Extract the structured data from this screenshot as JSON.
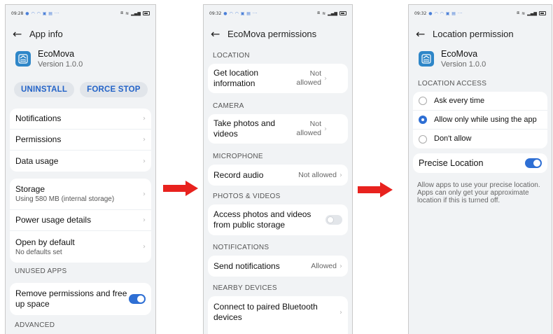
{
  "arrow_color": "#e8221e",
  "accent_color": "#2e6fd4",
  "screen1": {
    "status": {
      "time": "09:28",
      "net": "0.0\nK/s",
      "icons": "signal-wifi-battery"
    },
    "title": "App info",
    "app": {
      "name": "EcoMova",
      "version": "Version 1.0.0"
    },
    "buttons": {
      "uninstall": "UNINSTALL",
      "force_stop": "FORCE STOP"
    },
    "group1": [
      {
        "label": "Notifications"
      },
      {
        "label": "Permissions"
      },
      {
        "label": "Data usage"
      }
    ],
    "group2": [
      {
        "label": "Storage",
        "sub": "Using 580 MB (internal storage)"
      },
      {
        "label": "Power usage details"
      },
      {
        "label": "Open by default",
        "sub": "No defaults set"
      }
    ],
    "unused_section": "UNUSED APPS",
    "remove_perms": {
      "label": "Remove permissions and free up space",
      "on": true
    },
    "advanced_section": "ADVANCED"
  },
  "screen2": {
    "status": {
      "time": "09:32"
    },
    "title": "EcoMova permissions",
    "sections": [
      {
        "header": "LOCATION",
        "label": "Get location information",
        "value": "Not allowed"
      },
      {
        "header": "CAMERA",
        "label": "Take photos and videos",
        "value": "Not allowed"
      },
      {
        "header": "MICROPHONE",
        "label": "Record audio",
        "value": "Not allowed"
      },
      {
        "header": "PHOTOS & VIDEOS",
        "label": "Access photos and videos from public storage",
        "toggle": false
      },
      {
        "header": "NOTIFICATIONS",
        "label": "Send notifications",
        "value": "Allowed"
      },
      {
        "header": "NEARBY DEVICES",
        "label": "Connect to paired Bluetooth devices",
        "value": ""
      }
    ]
  },
  "screen3": {
    "status": {
      "time": "09:32"
    },
    "title": "Location permission",
    "app": {
      "name": "EcoMova",
      "version": "Version 1.0.0"
    },
    "section": "LOCATION ACCESS",
    "options": [
      {
        "label": "Ask every time",
        "selected": false
      },
      {
        "label": "Allow only while using the app",
        "selected": true
      },
      {
        "label": "Don't allow",
        "selected": false
      }
    ],
    "precise": {
      "label": "Precise Location",
      "on": true
    },
    "description": "Allow apps to use your precise location. Apps can only get your approximate location if this is turned off."
  }
}
